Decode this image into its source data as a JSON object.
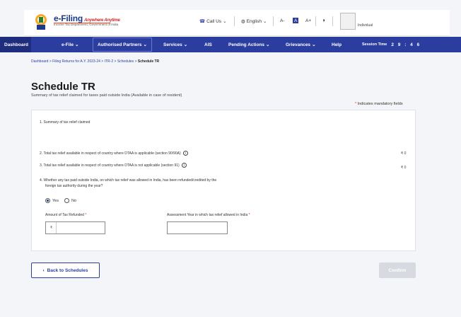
{
  "header": {
    "brand": "e-Filing",
    "brand_tagline": "Anywhere Anytime",
    "brand_dept": "Income Tax Department, Government of India",
    "call_us": "Call Us",
    "language": "English",
    "font_decrease": "A-",
    "font_normal": "A",
    "font_increase": "A+",
    "contrast_icon": "contrast-icon",
    "user_role": "Individual"
  },
  "nav": {
    "items": [
      "Dashboard",
      "e-File",
      "Authorised Partners",
      "Services",
      "AIS",
      "Pending Actions",
      "Grievances",
      "Help"
    ],
    "session_label": "Session Time",
    "session_value": "2 9 : 4 6"
  },
  "breadcrumb": {
    "items": [
      "Dashboard",
      "Filing Returns for A.Y. 2023-24",
      "ITR-2",
      "Schedules",
      "Schedule TR"
    ],
    "separator": ">"
  },
  "page": {
    "title": "Schedule TR",
    "subtitle": "Summary of tax relief claimed for taxes paid outside India (Available in case of resident)",
    "mandatory_note": "Indicates mandatory fields"
  },
  "form": {
    "q1": "1. Summary of tax relief claimed",
    "q2": "2. Total tax relief available in respect of country where DTAA is applicable (section 90/90A)",
    "q2_amount": "₹ 0",
    "q3": "3. Total tax relief available in respect of country where DTAA is not applicable (section 91)",
    "q3_amount": "₹ 0",
    "q4_line1": "4. Whether any tax paid outside India, on which tax relief was allowed in India, has been refunded/credited by the",
    "q4_line2": "foreign tax authority during the year?",
    "radio_yes": "Yes",
    "radio_no": "No",
    "selected": "Yes",
    "amount_label": "Amount of Tax Refunded",
    "amount_value": "",
    "year_label": "Assessment Year in which tax relief allowed in India",
    "year_value": "",
    "currency_symbol": "₹"
  },
  "buttons": {
    "back": "Back to Schedules",
    "confirm": "Confirm"
  },
  "colors": {
    "nav_bg": "#2b3ea0",
    "accent": "#1b3a8c",
    "required": "#d32f2f",
    "disabled_button": "#d7dae0"
  }
}
